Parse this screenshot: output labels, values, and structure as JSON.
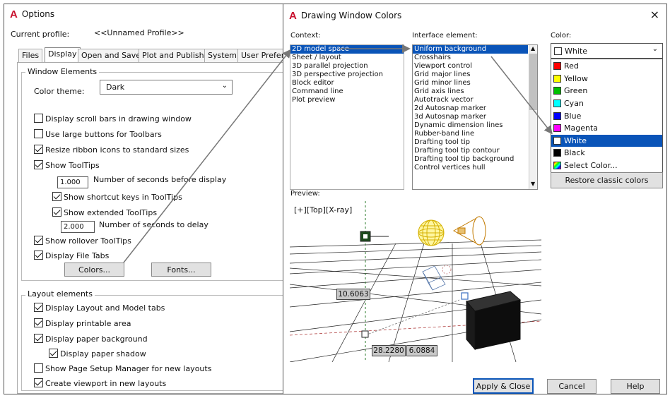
{
  "options": {
    "title": "Options",
    "current_profile_label": "Current profile:",
    "current_profile_value": "<<Unnamed Profile>>",
    "tabs": [
      "Files",
      "Display",
      "Open and Save",
      "Plot and Publish",
      "System",
      "User Prefere"
    ],
    "window_elements": {
      "title": "Window Elements",
      "color_theme_label": "Color theme:",
      "color_theme_value": "Dark",
      "scroll_bars": "Display scroll bars in drawing window",
      "large_buttons": "Use large buttons for Toolbars",
      "resize_ribbon": "Resize ribbon icons to standard sizes",
      "show_tooltips": "Show ToolTips",
      "seconds_before_value": "1.000",
      "seconds_before_label": "Number of seconds before display",
      "shortcut_keys": "Show shortcut keys in ToolTips",
      "extended_tooltips": "Show extended ToolTips",
      "delay_value": "2.000",
      "delay_label": "Number of seconds to delay",
      "rollover_tooltips": "Show rollover ToolTips",
      "file_tabs": "Display File Tabs",
      "colors_button": "Colors...",
      "fonts_button": "Fonts..."
    },
    "layout_elements": {
      "title": "Layout elements",
      "layout_model_tabs": "Display Layout and Model tabs",
      "printable_area": "Display printable area",
      "paper_background": "Display paper background",
      "paper_shadow": "Display paper shadow",
      "page_setup": "Show Page Setup Manager for new layouts",
      "create_viewport": "Create viewport in new layouts"
    }
  },
  "colors_dialog": {
    "title": "Drawing Window Colors",
    "close": "×",
    "context_label": "Context:",
    "context_items": [
      "2D model space",
      "Sheet / layout",
      "3D parallel projection",
      "3D perspective projection",
      "Block editor",
      "Command line",
      "Plot preview"
    ],
    "interface_label": "Interface element:",
    "interface_items": [
      "Uniform background",
      "Crosshairs",
      "Viewport control",
      "Grid major lines",
      "Grid minor lines",
      "Grid axis lines",
      "Autotrack vector",
      "2d Autosnap marker",
      "3d Autosnap marker",
      "Dynamic dimension lines",
      "Rubber-band line",
      "Drafting tool tip",
      "Drafting tool tip contour",
      "Drafting tool tip background",
      "Control vertices hull"
    ],
    "color_label": "Color:",
    "color_selected": "White",
    "color_options": [
      {
        "name": "Red",
        "hex": "#ff0000"
      },
      {
        "name": "Yellow",
        "hex": "#ffff00"
      },
      {
        "name": "Green",
        "hex": "#00c000"
      },
      {
        "name": "Cyan",
        "hex": "#00ffff"
      },
      {
        "name": "Blue",
        "hex": "#0000ff"
      },
      {
        "name": "Magenta",
        "hex": "#ff00ff"
      },
      {
        "name": "White",
        "hex": "#ffffff"
      },
      {
        "name": "Black",
        "hex": "#000000"
      },
      {
        "name": "Select Color...",
        "hex": "multicolor"
      }
    ],
    "restore_button": "Restore classic colors",
    "preview_label": "Preview:",
    "viewport_label": "[+][Top][X-ray]",
    "dim_1": "10.6063",
    "dim_2": "28.2280",
    "dim_3": "6.0884",
    "apply_button": "Apply & Close",
    "cancel_button": "Cancel",
    "help_button": "Help"
  }
}
